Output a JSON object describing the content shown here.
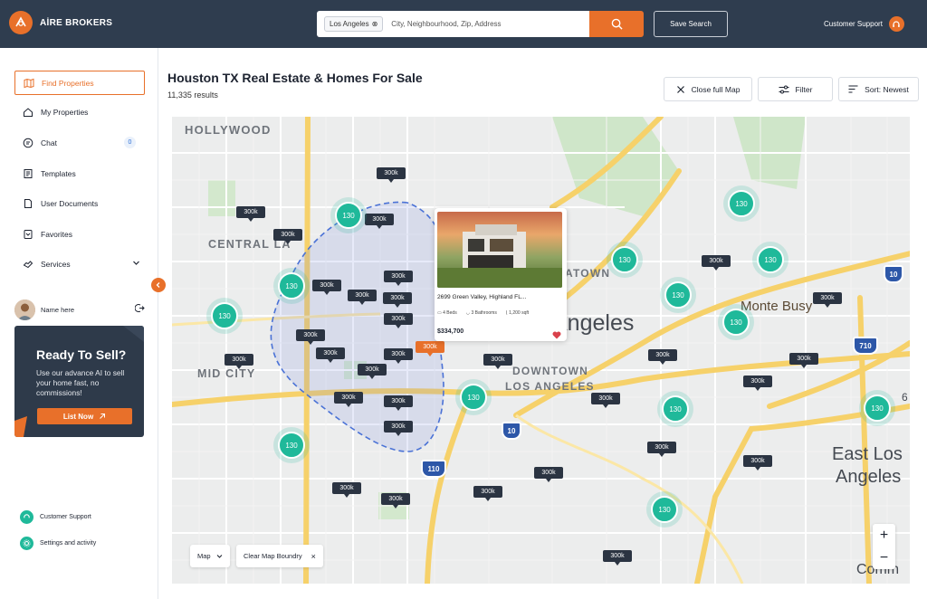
{
  "brand": {
    "name": "AİRE BROKERS"
  },
  "header": {
    "search_chip": "Los Angeles",
    "search_placeholder": "City, Neighbourhood, Zip, Address",
    "save_search_label": "Save Search",
    "support_label": "Customer Support"
  },
  "sidebar": {
    "items": [
      {
        "label": "Find Properties"
      },
      {
        "label": "My Properties"
      },
      {
        "label": "Chat",
        "badge": "0"
      },
      {
        "label": "Templates"
      },
      {
        "label": "User Documents"
      },
      {
        "label": "Favorites"
      },
      {
        "label": "Services"
      }
    ],
    "user_name": "Name here",
    "promo": {
      "title": "Ready To Sell?",
      "text": "Use our advance AI to sell your home fast, no commissions!",
      "button": "List Now"
    },
    "footer": {
      "support": "Customer Support",
      "settings": "Settings and activity"
    }
  },
  "main": {
    "title": "Houston TX Real Estate & Homes For Sale",
    "results": "11,335 results",
    "close_map": "Close full Map",
    "filter": "Filter",
    "sort": "Sort: Newest"
  },
  "map": {
    "labels": {
      "hollywood": "HOLLYWOOD",
      "central_la": "CENTRAL LA",
      "mid_city": "MID CITY",
      "downtown": "DOWNTOWN",
      "los_angeles": "LOS ANGELES",
      "angeles": "Angeles",
      "chinatown": "ATOWN",
      "monte_busy": "Monte Busy",
      "east_los": "East Los",
      "east_angeles": "Angeles",
      "commerce": "Comm",
      "partial_digit": "6"
    },
    "highways": {
      "h10a": "10",
      "h10b": "10",
      "h110": "110",
      "h710": "710"
    },
    "pin_label": "300k",
    "cluster_label": "130",
    "card": {
      "address": "2699 Green Valley, Highland FL...",
      "beds": "4 Beds",
      "baths": "3 Bathrooms",
      "area": "1,200 sqft",
      "price": "$334,700"
    },
    "map_type": "Map",
    "clear_boundary": "Clear Map Boundry",
    "zoom_in": "+",
    "zoom_out": "−"
  },
  "colors": {
    "accent": "#e8702a",
    "topbar": "#2f3d4f",
    "cluster": "#1fb99a",
    "pin": "#2b3442"
  }
}
